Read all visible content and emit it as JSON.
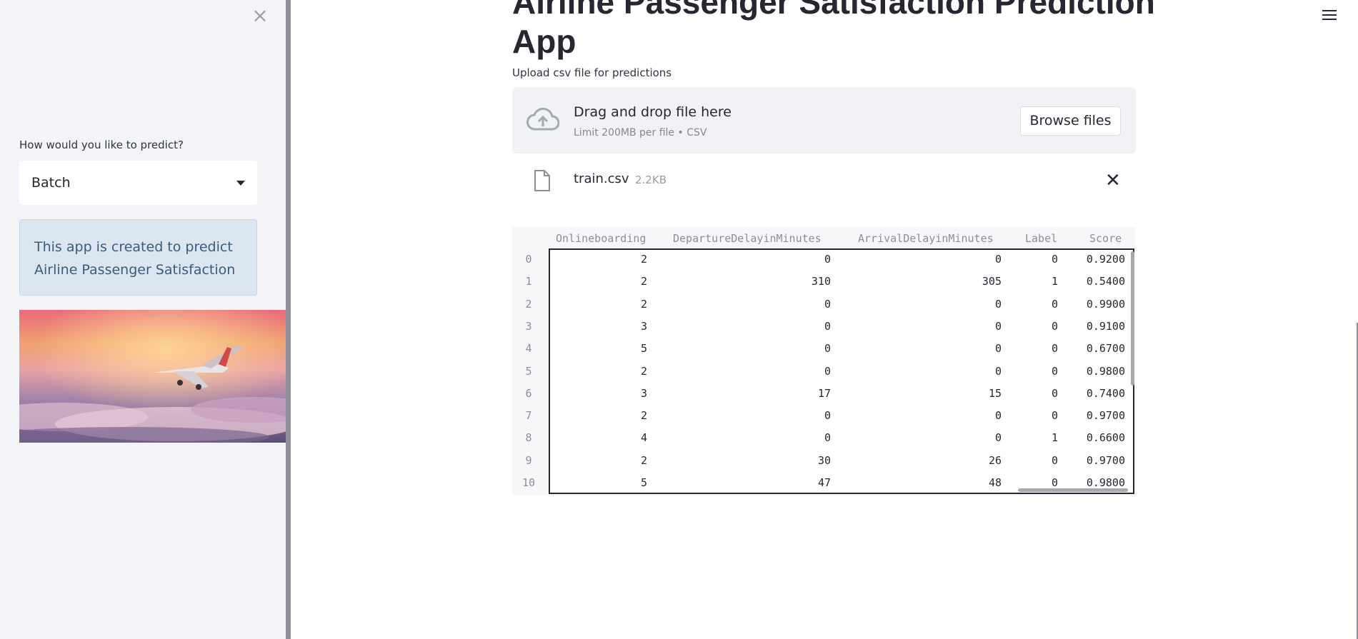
{
  "sidebar": {
    "close_icon": "×",
    "predict_label": "How would you like to predict?",
    "select_value": "Batch",
    "info_text": "This app is created to predict Airline Passenger Satisfaction"
  },
  "main": {
    "title": "Airline Passenger Satisfaction Prediction App",
    "upload_label": "Upload csv file for predictions",
    "drop_title": "Drag and drop file here",
    "drop_subtitle": "Limit 200MB per file • CSV",
    "browse_label": "Browse files",
    "file": {
      "name": "train.csv",
      "size": "2.2KB",
      "remove_icon": "✕"
    }
  },
  "table": {
    "columns": [
      "Onlineboarding",
      "DepartureDelayinMinutes",
      "ArrivalDelayinMinutes",
      "Label",
      "Score"
    ],
    "rows": [
      {
        "index": "0",
        "cells": [
          "2",
          "0",
          "0",
          "0",
          "0.9200"
        ]
      },
      {
        "index": "1",
        "cells": [
          "2",
          "310",
          "305",
          "1",
          "0.5400"
        ]
      },
      {
        "index": "2",
        "cells": [
          "2",
          "0",
          "0",
          "0",
          "0.9900"
        ]
      },
      {
        "index": "3",
        "cells": [
          "3",
          "0",
          "0",
          "0",
          "0.9100"
        ]
      },
      {
        "index": "4",
        "cells": [
          "5",
          "0",
          "0",
          "0",
          "0.6700"
        ]
      },
      {
        "index": "5",
        "cells": [
          "2",
          "0",
          "0",
          "0",
          "0.9800"
        ]
      },
      {
        "index": "6",
        "cells": [
          "3",
          "17",
          "15",
          "0",
          "0.7400"
        ]
      },
      {
        "index": "7",
        "cells": [
          "2",
          "0",
          "0",
          "0",
          "0.9700"
        ]
      },
      {
        "index": "8",
        "cells": [
          "4",
          "0",
          "0",
          "1",
          "0.6600"
        ]
      },
      {
        "index": "9",
        "cells": [
          "2",
          "30",
          "26",
          "0",
          "0.9700"
        ]
      },
      {
        "index": "10",
        "cells": [
          "5",
          "47",
          "48",
          "0",
          "0.9800"
        ]
      }
    ]
  }
}
